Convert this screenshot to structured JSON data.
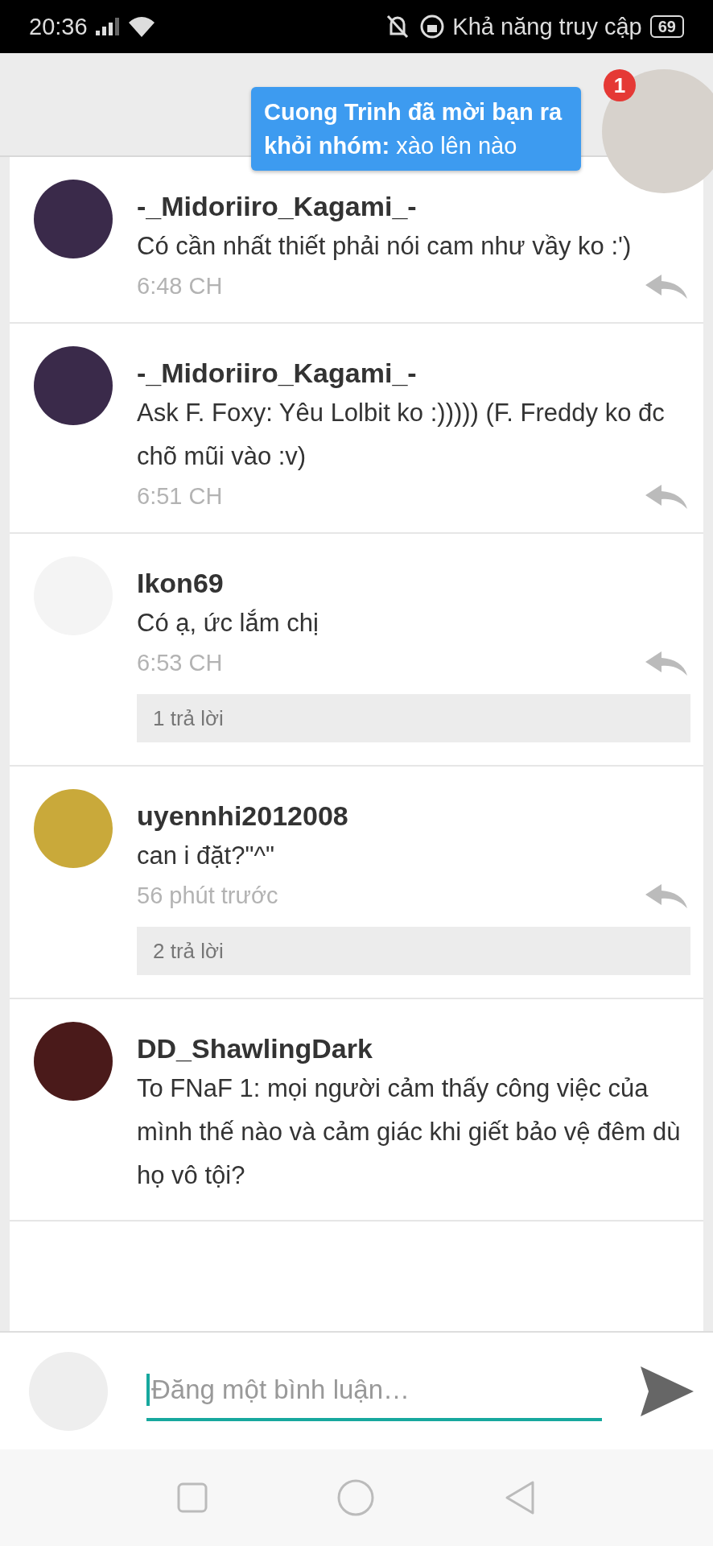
{
  "status_bar": {
    "time": "20:36",
    "accessibility": "Khả năng truy cập",
    "battery": "69"
  },
  "notification": {
    "sender": "Cuong Trinh đã mời bạn ra khỏi nhóm:",
    "message": "xào lên nào",
    "badge": "1"
  },
  "comments": [
    {
      "author": "-_Midoriiro_Kagami_-",
      "text": "Có cần nhất thiết phải nói cam như vầy ko :')",
      "time": "6:48 CH"
    },
    {
      "author": "-_Midoriiro_Kagami_-",
      "text": "Ask F. Foxy: Yêu Lolbit ko :))))) (F. Freddy ko đc chõ mũi vào :v)",
      "time": "6:51 CH"
    },
    {
      "author": "Ikon69",
      "text": "Có ạ, ức lắm chị",
      "time": "6:53 CH",
      "replies": "1 trả lời"
    },
    {
      "author": "uyennhi2012008",
      "text": "can i đặt?\"^\"",
      "time": "56 phút trước",
      "replies": "2 trả lời"
    },
    {
      "author": "DD_ShawlingDark",
      "text": "To FNaF 1: mọi người cảm thấy công việc của mình thế nào và cảm giác khi giết bảo vệ đêm dù họ vô tội?"
    }
  ],
  "composer": {
    "placeholder": "Đăng một bình luận…"
  }
}
